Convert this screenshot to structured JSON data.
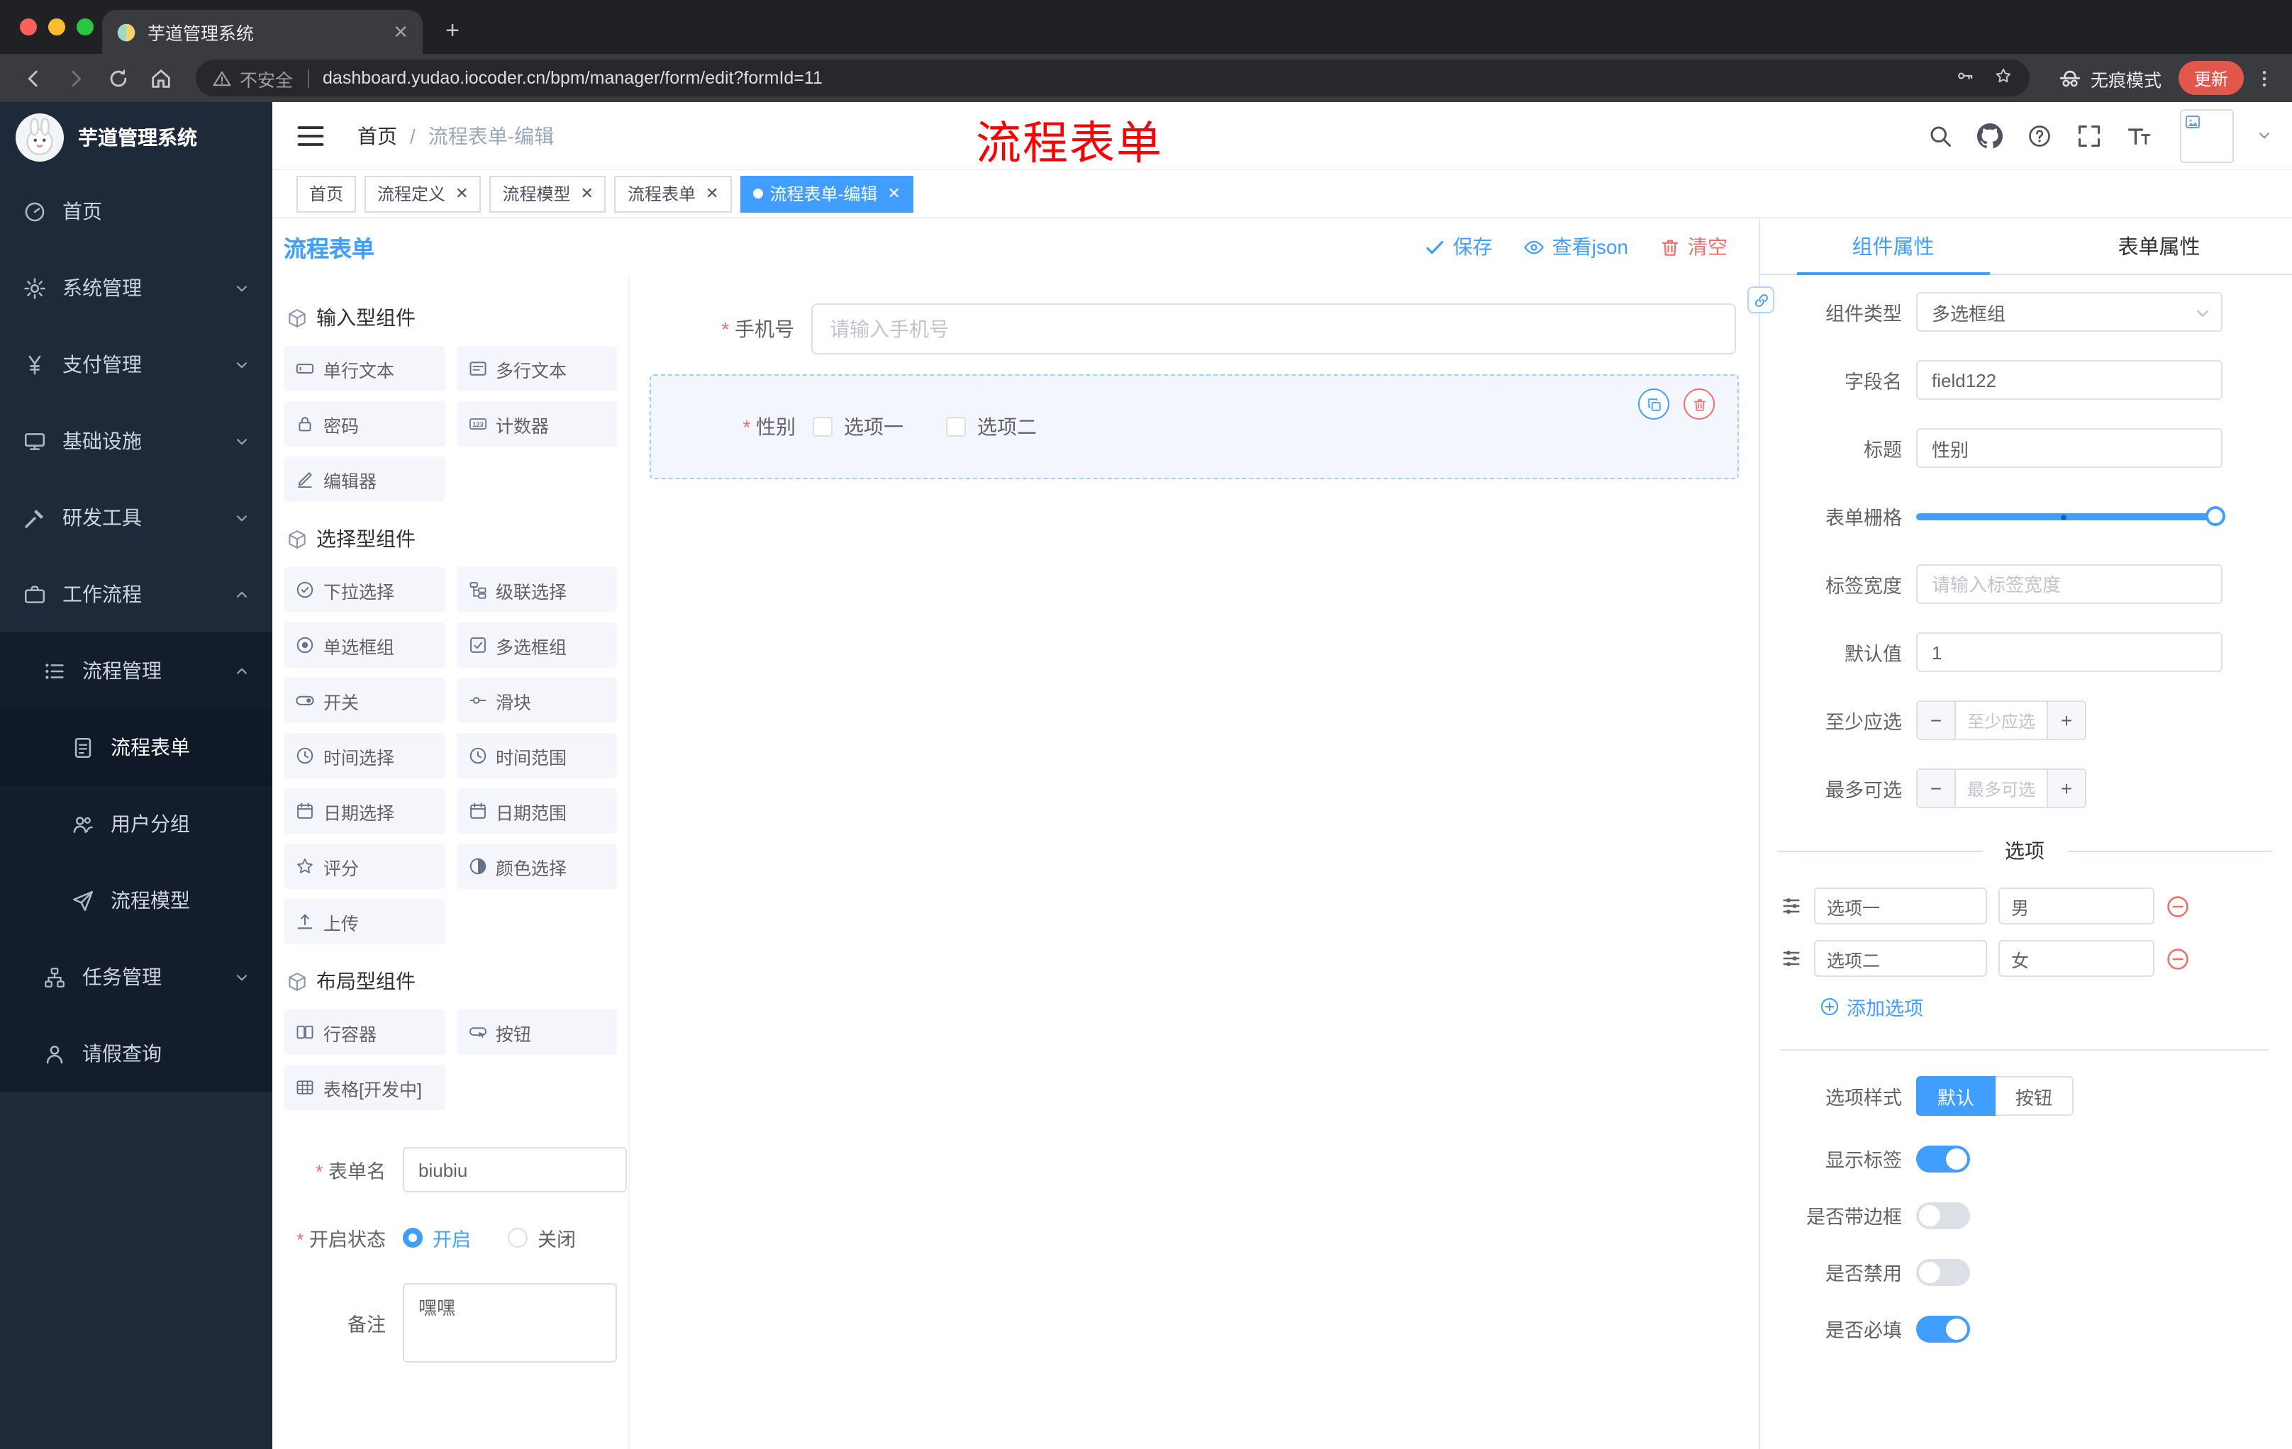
{
  "chrome": {
    "tab_title": "芋道管理系统",
    "security_label": "不安全",
    "url": "dashboard.yudao.iocoder.cn/bpm/manager/form/edit?formId=11",
    "incognito_label": "无痕模式",
    "update_label": "更新"
  },
  "sidebar": {
    "title": "芋道管理系统",
    "items": [
      "首页",
      "系统管理",
      "支付管理",
      "基础设施",
      "研发工具",
      "工作流程",
      "流程管理",
      "流程表单",
      "用户分组",
      "流程模型",
      "任务管理",
      "请假查询"
    ]
  },
  "header": {
    "breadcrumb_home": "首页",
    "breadcrumb_sep": "/",
    "breadcrumb_current": "流程表单-编辑"
  },
  "annotation": "流程表单",
  "tags": [
    "首页",
    "流程定义",
    "流程模型",
    "流程表单",
    "流程表单-编辑"
  ],
  "designer": {
    "title": "流程表单",
    "save": "保存",
    "view_json": "查看json",
    "clear": "清空",
    "palette": {
      "group1_title": "输入型组件",
      "group1": [
        "单行文本",
        "多行文本",
        "密码",
        "计数器",
        "编辑器"
      ],
      "group2_title": "选择型组件",
      "group2": [
        "下拉选择",
        "级联选择",
        "单选框组",
        "多选框组",
        "开关",
        "滑块",
        "时间选择",
        "时间范围",
        "日期选择",
        "日期范围",
        "评分",
        "颜色选择",
        "上传"
      ],
      "group3_title": "布局型组件",
      "group3": [
        "行容器",
        "按钮",
        "表格[开发中]"
      ]
    },
    "meta": {
      "name_label": "表单名",
      "name_value": "biubiu",
      "status_label": "开启状态",
      "status_on": "开启",
      "status_off": "关闭",
      "status_selected": "开启",
      "remark_label": "备注",
      "remark_value": "嘿嘿"
    },
    "canvas": {
      "phone_label": "手机号",
      "phone_placeholder": "请输入手机号",
      "gender_label": "性别",
      "gender_opt1": "选项一",
      "gender_opt2": "选项二"
    }
  },
  "props": {
    "tab_component": "组件属性",
    "tab_form": "表单属性",
    "type_label": "组件类型",
    "type_value": "多选框组",
    "field_label": "字段名",
    "field_value": "field122",
    "title_label": "标题",
    "title_value": "性别",
    "grid_label": "表单栅格",
    "width_label": "标签宽度",
    "width_placeholder": "请输入标签宽度",
    "default_label": "默认值",
    "default_value": "1",
    "min_label": "至少应选",
    "min_placeholder": "至少应选",
    "max_label": "最多可选",
    "max_placeholder": "最多可选",
    "options_title": "选项",
    "options": [
      {
        "label": "选项一",
        "value": "男"
      },
      {
        "label": "选项二",
        "value": "女"
      }
    ],
    "add_option": "添加选项",
    "style_label": "选项样式",
    "style_default": "默认",
    "style_button": "按钮",
    "show_label": "显示标签",
    "border_label": "是否带边框",
    "disabled_label": "是否禁用",
    "required_label": "是否必填"
  },
  "colors": {
    "primary": "#409eff",
    "danger": "#f56c6c",
    "annotation_red": "#ff0000",
    "sidebar_bg": "#1e2a3a",
    "chrome_bg": "#202124",
    "update_pill": "#e2574c"
  },
  "icons": {
    "save": "check",
    "view_json": "eye",
    "clear": "trash",
    "copy_component": "copy",
    "delete_component": "trash",
    "add_option": "plus-circle",
    "remove_option": "minus-circle",
    "option_drag": "sliders",
    "header_right": [
      "search",
      "github",
      "question",
      "fullscreen",
      "font-size"
    ]
  }
}
